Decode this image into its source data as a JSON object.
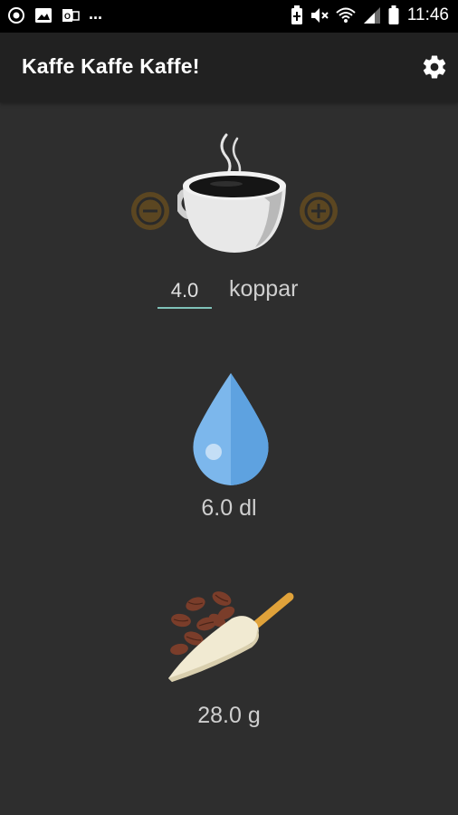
{
  "status_bar": {
    "time": "11:46",
    "overflow": "...",
    "left_icons": [
      "notification-icon",
      "image-icon",
      "outlook-icon"
    ],
    "right_icons": [
      "battery-saver-icon",
      "mute-icon",
      "wifi-icon",
      "signal-icon",
      "battery-icon"
    ]
  },
  "app_bar": {
    "title": "Kaffe Kaffe Kaffe!",
    "settings_icon": "gear-icon"
  },
  "cups": {
    "value": "4.0",
    "unit": "koppar",
    "decrement_icon": "minus-icon",
    "increment_icon": "plus-icon",
    "illustration": "coffee-cup-icon"
  },
  "water": {
    "value": "6.0 dl",
    "illustration": "water-drop-icon"
  },
  "coffee": {
    "value": "28.0 g",
    "illustration": "coffee-scoop-icon"
  },
  "colors": {
    "background": "#2e2e2e",
    "app_bar": "#212121",
    "status_bar": "#000000",
    "input_underline": "#7fc1b8",
    "stepper_button": "#5b4621",
    "stepper_glyph": "#2a2a2a"
  }
}
